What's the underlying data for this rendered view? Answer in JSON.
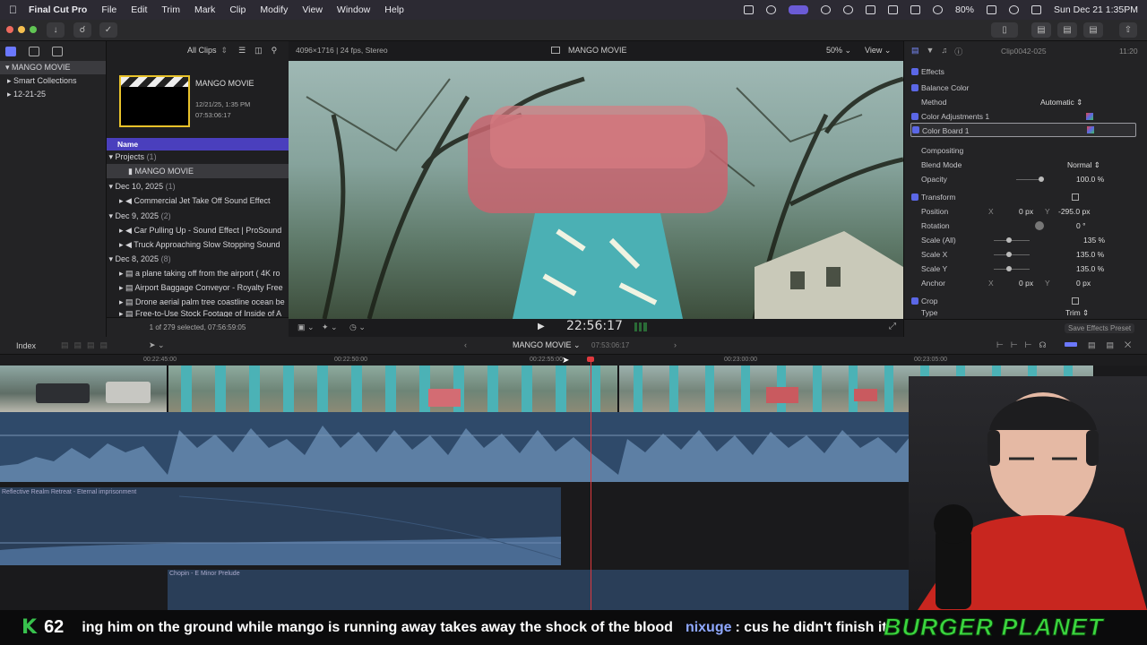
{
  "menubar": {
    "app": "Final Cut Pro",
    "items": [
      "File",
      "Edit",
      "Trim",
      "Mark",
      "Clip",
      "Modify",
      "View",
      "Window",
      "Help"
    ],
    "battery": "80%",
    "datetime": "Sun Dec 21  1:35PM"
  },
  "library": {
    "items": [
      {
        "label": "MANGO MOVIE"
      },
      {
        "label": "Smart Collections"
      },
      {
        "label": "12-21-25"
      }
    ]
  },
  "browser": {
    "filter": "All Clips",
    "project_name": "MANGO MOVIE",
    "project_date": "12/21/25, 1:35 PM",
    "project_duration": "07:53:06:17",
    "col_name": "Name",
    "groups": [
      {
        "label": "Projects",
        "count": "(1)",
        "items": [
          "MANGO MOVIE"
        ]
      },
      {
        "label": "Dec 10, 2025",
        "count": "(1)",
        "items": [
          "Commercial Jet Take Off Sound Effect"
        ]
      },
      {
        "label": "Dec 9, 2025",
        "count": "(2)",
        "items": [
          "Car Pulling Up - Sound Effect  |  ProSound",
          "Truck Approaching Slow Stopping Sound"
        ]
      },
      {
        "label": "Dec 8, 2025",
        "count": "(8)",
        "items": [
          "a plane taking off from the airport ( 4K ro",
          "Airport Baggage Conveyor - Royalty Free",
          "Drone aerial palm tree coastline ocean be",
          "Free-to-Use Stock Footage of Inside of A"
        ]
      }
    ],
    "status": "1 of 279 selected, 07:56:59:05"
  },
  "viewer": {
    "format": "4096×1716 | 24 fps, Stereo",
    "title": "MANGO MOVIE",
    "zoom": "50%",
    "view_menu": "View",
    "timecode": "22:56:17"
  },
  "inspector": {
    "clip_name": "Clip0042-025",
    "duration": "11:20",
    "sections": {
      "effects": "Effects",
      "balance_color": "Balance Color",
      "method_label": "Method",
      "method_value": "Automatic",
      "color_adjustments": "Color Adjustments 1",
      "color_board": "Color Board 1",
      "compositing": "Compositing",
      "blend_label": "Blend Mode",
      "blend_value": "Normal",
      "opacity_label": "Opacity",
      "opacity_value": "100.0 %",
      "transform": "Transform",
      "position_label": "Position",
      "pos_x": "0 px",
      "pos_y": "-295.0 px",
      "rotation_label": "Rotation",
      "rotation_value": "0 °",
      "scale_all_label": "Scale (All)",
      "scale_all_value": "135 %",
      "scale_x_label": "Scale X",
      "scale_x_value": "135.0 %",
      "scale_y_label": "Scale Y",
      "scale_y_value": "135.0 %",
      "anchor_label": "Anchor",
      "anchor_x": "0 px",
      "anchor_y": "0 px",
      "crop": "Crop",
      "type_label": "Type",
      "type_value": "Trim",
      "save_preset": "Save Effects Preset"
    }
  },
  "timeline": {
    "index": "Index",
    "project": "MANGO MOVIE",
    "duration": "07:53:06:17",
    "ruler": [
      "00:22:45:00",
      "00:22:50:00",
      "00:22:55:00",
      "00:23:00:00",
      "00:23:05:00"
    ],
    "audio_clip_1": "Reflective Realm Retreat - Eternal imprisonment",
    "audio_clip_2": "Chopin - E Minor Prelude"
  },
  "ticker": {
    "logo": "K",
    "number": "62",
    "chat_text": "ing him on the ground while mango is running away takes away the shock of the blood",
    "username": "nixuge",
    "message": ": cus he didn't finish it",
    "brand": "BURGER PLANET"
  }
}
